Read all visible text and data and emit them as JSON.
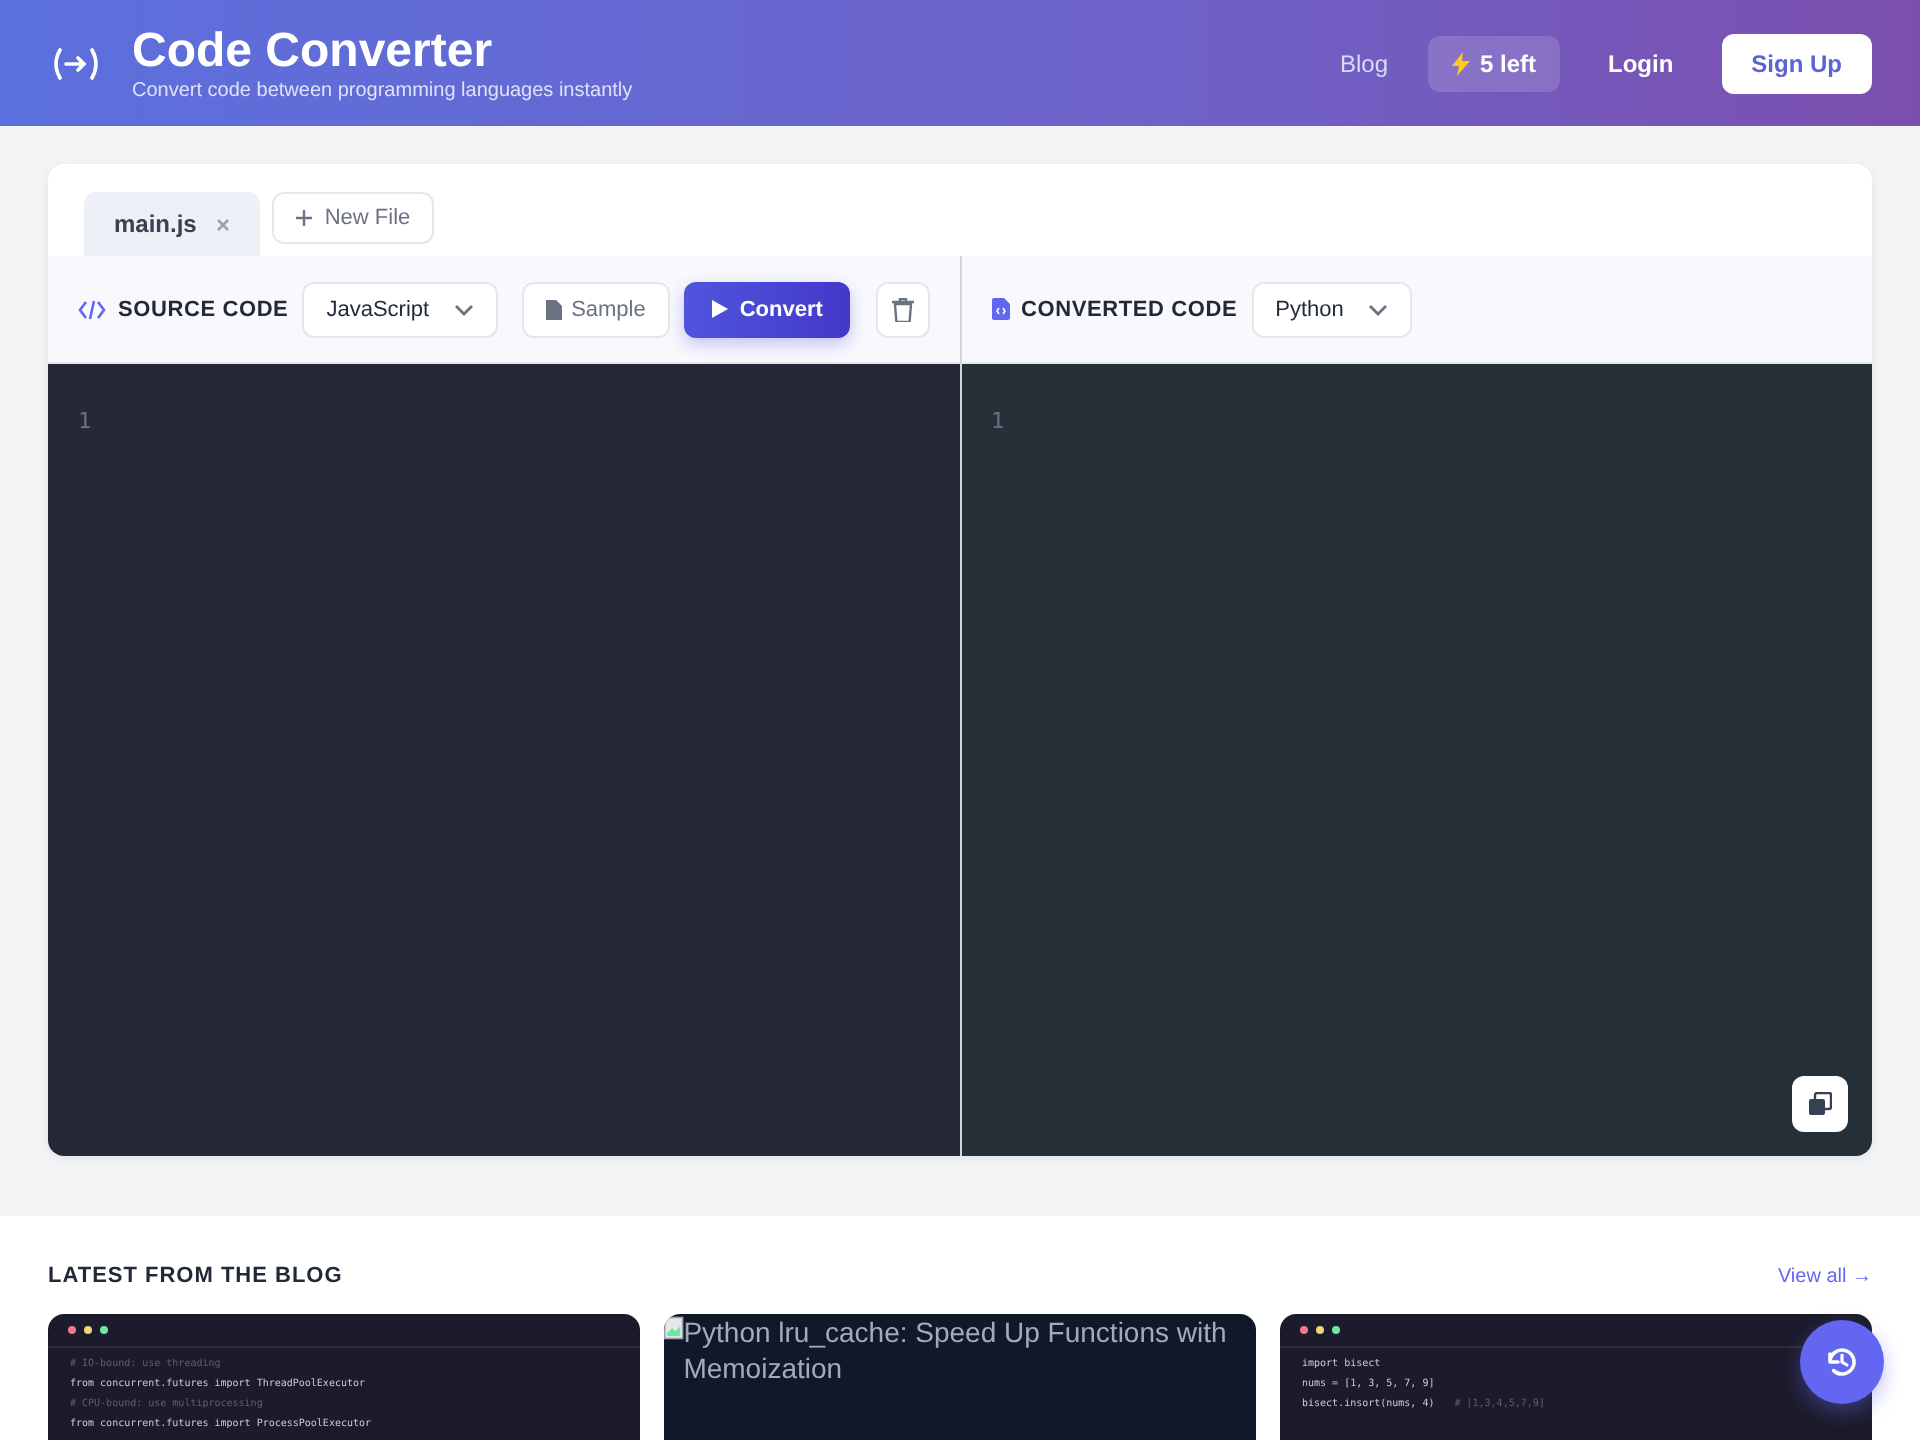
{
  "header": {
    "title": "Code Converter",
    "subtitle": "Convert code between programming languages instantly",
    "nav": [
      {
        "kind": "link",
        "label": "Blog"
      },
      {
        "kind": "credits",
        "label": "5 left"
      },
      {
        "kind": "login",
        "label": "Login"
      },
      {
        "kind": "primary",
        "label": "Sign Up"
      }
    ]
  },
  "file_tabs": [
    {
      "label": "main.js",
      "selected": true
    }
  ],
  "new_file_button": "New File",
  "source": {
    "heading": "SOURCE CODE",
    "language": "JavaScript",
    "sample_button": "Sample",
    "convert_button": "Convert",
    "line_numbers": [
      "1"
    ]
  },
  "converted": {
    "heading": "CONVERTED CODE",
    "language": "Python",
    "line_numbers": [
      "1"
    ]
  },
  "blog": {
    "heading": "LATEST FROM THE BLOG",
    "view_all": "View all →",
    "posts": [
      {
        "kind": "code",
        "lines": [
          {
            "code": "# IO-bound: use threading",
            "comment": true
          },
          {
            "code": "from concurrent.futures import ThreadPoolExecutor",
            "comment": false
          },
          {
            "code": "# CPU-bound: use multiprocessing",
            "comment": true
          },
          {
            "code": "from concurrent.futures import ProcessPoolExecutor",
            "comment": false
          }
        ]
      },
      {
        "kind": "broken_image",
        "alt_text": "Python lru_cache: Speed Up Functions with Memoization"
      },
      {
        "kind": "code",
        "lines": [
          {
            "code": "import bisect",
            "comment": false
          },
          {
            "code": "nums = [1, 3, 5, 7, 9]",
            "comment": false
          },
          {
            "code": "bisect.insort(nums, 4)",
            "note": "# [1,3,4,5,7,9]",
            "comment": false
          }
        ]
      }
    ]
  }
}
